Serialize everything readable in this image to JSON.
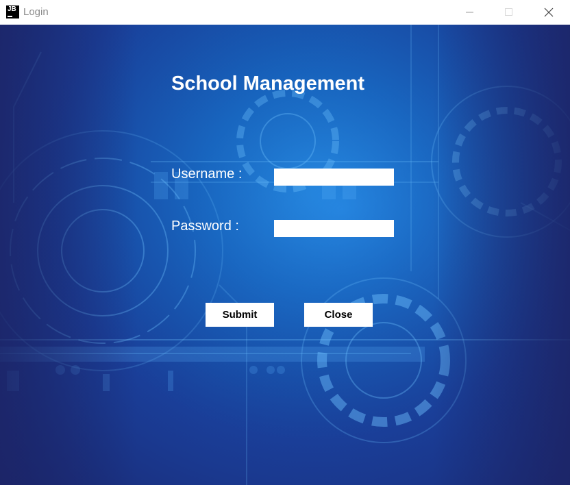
{
  "window": {
    "app_icon_text": "JB",
    "title": "Login",
    "controls": {
      "minimize": "minimize-icon",
      "maximize": "maximize-icon",
      "close": "close-icon"
    }
  },
  "form": {
    "heading": "School Management",
    "username_label": "Username :",
    "username_value": "",
    "password_label": "Password :",
    "password_value": "",
    "submit_label": "Submit",
    "close_label": "Close"
  },
  "colors": {
    "background_primary": "#1565c0",
    "background_dark": "#1a2770",
    "text": "#ffffff"
  }
}
